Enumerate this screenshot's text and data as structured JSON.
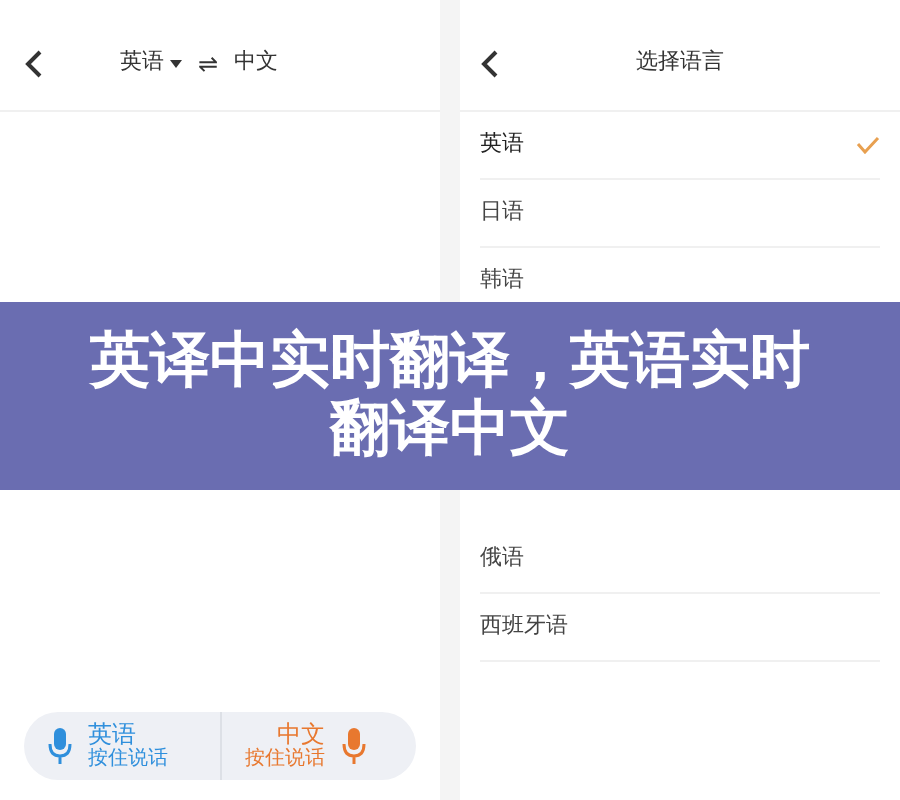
{
  "left_screen": {
    "header": {
      "source_language": "英语",
      "swap_icon": "⇌",
      "target_language": "中文"
    },
    "voice_buttons": [
      {
        "language": "英语",
        "hint": "按住说话",
        "color": "#2f8fdc"
      },
      {
        "language": "中文",
        "hint": "按住说话",
        "color": "#e8782f"
      }
    ]
  },
  "right_screen": {
    "title": "选择语言",
    "languages": [
      {
        "label": "英语",
        "selected": true
      },
      {
        "label": "日语",
        "selected": false
      },
      {
        "label": "韩语",
        "selected": false
      },
      {
        "label": "俄语",
        "selected": false
      },
      {
        "label": "西班牙语",
        "selected": false
      }
    ]
  },
  "banner": {
    "title": "英译中实时翻译，英语实时翻译中文"
  }
}
